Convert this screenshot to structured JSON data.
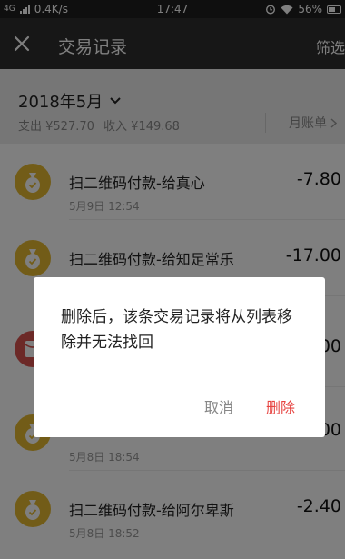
{
  "status_bar": {
    "network": "4G",
    "speed": "0.4K/s",
    "time": "17:47",
    "battery": "56%",
    "icons": [
      "signal-icon",
      "alarm-icon",
      "wifi-icon",
      "battery-icon"
    ]
  },
  "nav": {
    "title": "交易记录",
    "filter_label": "筛选",
    "close_icon": "close-icon"
  },
  "summary": {
    "month": "2018年5月",
    "expense": "支出 ¥527.70",
    "income": "收入 ¥149.68",
    "monthly_bill": "月账单"
  },
  "transactions": [
    {
      "name": "扫二维码付款-给真心",
      "time": "5月9日 12:54",
      "amount": "-7.80",
      "icon": "money-bag-icon",
      "color": "#e5b931"
    },
    {
      "name": "扫二维码付款-给知足常乐",
      "time": "",
      "amount": "-17.00",
      "icon": "money-bag-icon",
      "color": "#e5b931"
    },
    {
      "name": "",
      "time": "",
      "amount": "00",
      "icon": "red-packet-icon",
      "color": "#d9534f"
    },
    {
      "name": "",
      "time": "5月8日 18:54",
      "amount": "00",
      "icon": "money-bag-icon",
      "color": "#e5b931"
    },
    {
      "name": "扫二维码付款-给阿尔卑斯",
      "time": "5月8日 18:52",
      "amount": "-2.40",
      "icon": "money-bag-icon",
      "color": "#e5b931"
    }
  ],
  "dialog": {
    "message": "删除后，该条交易记录将从列表移除并无法找回",
    "cancel_label": "取消",
    "delete_label": "删除",
    "delete_color": "#e64340"
  }
}
